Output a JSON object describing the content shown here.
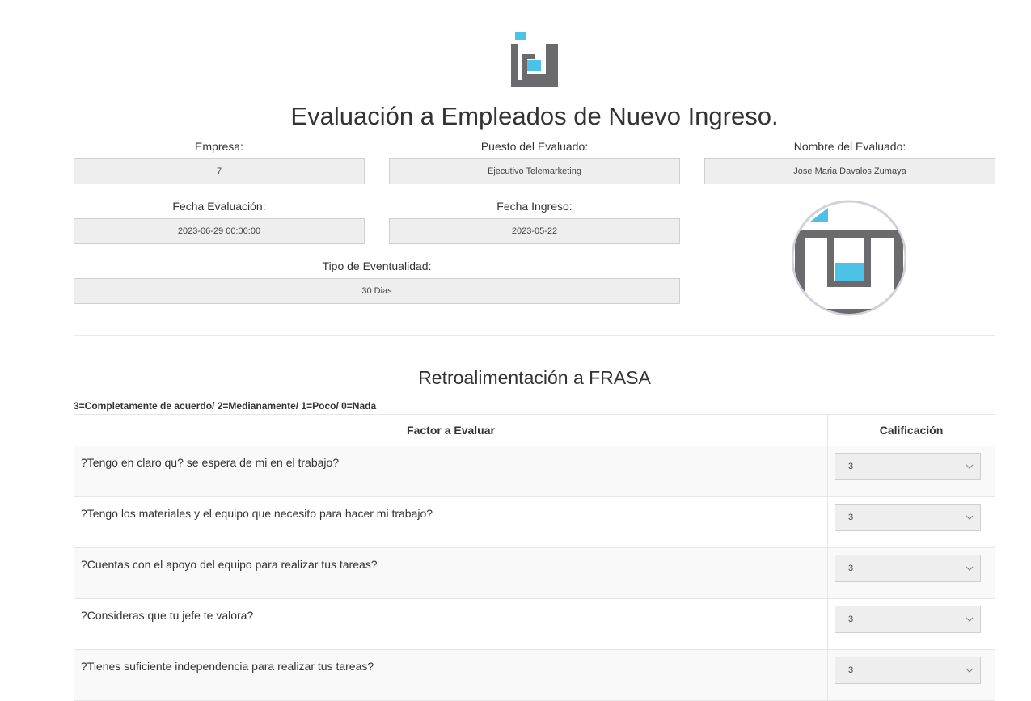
{
  "header": {
    "title": "Evaluación a Empleados de Nuevo Ingreso."
  },
  "fields": {
    "empresa": {
      "label": "Empresa:",
      "value": "7"
    },
    "puesto": {
      "label": "Puesto del Evaluado:",
      "value": "Ejecutivo Telemarketing"
    },
    "nombre": {
      "label": "Nombre del Evaluado:",
      "value": "Jose Maria Davalos Zumaya"
    },
    "fecha_evaluacion": {
      "label": "Fecha Evaluación:",
      "value": "2023-06-29 00:00:00"
    },
    "fecha_ingreso": {
      "label": "Fecha Ingreso:",
      "value": "2023-05-22"
    },
    "tipo_eventualidad": {
      "label": "Tipo de Eventualidad:",
      "value": "30 Dias"
    }
  },
  "feedback": {
    "title": "Retroalimentación a FRASA",
    "legend": "3=Completamente de acuerdo/ 2=Medianamente/ 1=Poco/ 0=Nada",
    "columns": [
      "Factor a Evaluar",
      "Calificación"
    ],
    "rows": [
      {
        "question": "?Tengo en claro qu? se espera de mi en el trabajo?",
        "rating": "3"
      },
      {
        "question": "?Tengo los materiales y el equipo que necesito para hacer mi trabajo?",
        "rating": "3"
      },
      {
        "question": "?Cuentas con el apoyo del equipo para realizar tus tareas?",
        "rating": "3"
      },
      {
        "question": "?Consideras que tu jefe te valora?",
        "rating": "3"
      },
      {
        "question": "?Tienes suficiente independencia para realizar tus tareas?",
        "rating": "3"
      }
    ]
  },
  "colors": {
    "brand_gray": "#6b6b6d",
    "brand_blue": "#4cc2e6"
  },
  "icons": {
    "logo": "company-logo",
    "avatar": "employee-avatar",
    "chevron": "chevron-down-icon"
  }
}
